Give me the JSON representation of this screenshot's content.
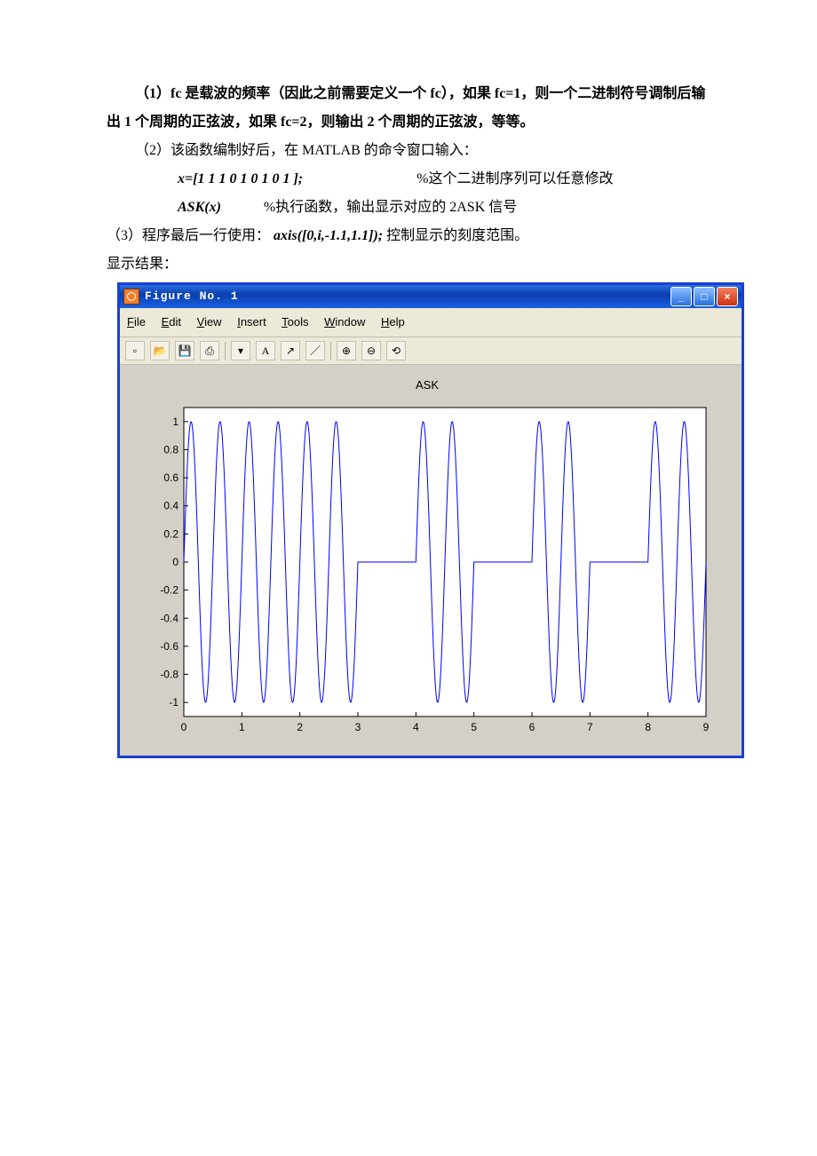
{
  "text": {
    "p1a": "（1）fc 是载波的频率（因此之前需要定义一个 fc），如果 fc=1，则一个二进制符号调制后输出 1 个周期的正弦波，如果 fc=2，则输出 2 个周期的正弦波，等等。",
    "p2": "（2）该函数编制好后，在 MATLAB 的命令窗口输入：",
    "code1": "x=[1 1 1 0 1 0 1 0 1 ];",
    "code1_comment": "%这个二进制序列可以任意修改",
    "code2": "ASK(x)",
    "code2_comment": "%执行函数，输出显示对应的 2ASK 信号",
    "p3a": "（3）程序最后一行使用：  ",
    "p3b": "axis([0,i,-1.1,1.1]);",
    "p3c": "   控制显示的刻度范围。",
    "p4": "显示结果："
  },
  "window": {
    "title": "Figure No. 1",
    "menu": {
      "file": "File",
      "edit": "Edit",
      "view": "View",
      "insert": "Insert",
      "tools": "Tools",
      "window": "Window",
      "help": "Help"
    }
  },
  "chart_data": {
    "type": "line",
    "title": "ASK",
    "xlabel": "",
    "ylabel": "",
    "xlim": [
      0,
      9
    ],
    "ylim": [
      -1.1,
      1.1
    ],
    "xticks": [
      0,
      1,
      2,
      3,
      4,
      5,
      6,
      7,
      8,
      9
    ],
    "yticks": [
      -1,
      -0.8,
      -0.6,
      -0.4,
      -0.2,
      0,
      0.2,
      0.4,
      0.6,
      0.8,
      1
    ],
    "bit_sequence": [
      1,
      1,
      1,
      0,
      1,
      0,
      1,
      0,
      1
    ],
    "fc": 2,
    "description": "2ASK signal: for each bit=1 emit fc sine periods of amplitude 1, for bit=0 emit zero line",
    "series": [
      {
        "name": "ASK",
        "color": "#0000ff",
        "segments": [
          {
            "x0": 0,
            "x1": 1,
            "type": "sine",
            "cycles": 2
          },
          {
            "x0": 1,
            "x1": 2,
            "type": "sine",
            "cycles": 2
          },
          {
            "x0": 2,
            "x1": 3,
            "type": "sine",
            "cycles": 2
          },
          {
            "x0": 3,
            "x1": 4,
            "type": "zero"
          },
          {
            "x0": 4,
            "x1": 5,
            "type": "sine",
            "cycles": 2
          },
          {
            "x0": 5,
            "x1": 6,
            "type": "zero"
          },
          {
            "x0": 6,
            "x1": 7,
            "type": "sine",
            "cycles": 2
          },
          {
            "x0": 7,
            "x1": 8,
            "type": "zero"
          },
          {
            "x0": 8,
            "x1": 9,
            "type": "sine",
            "cycles": 2
          }
        ]
      }
    ]
  }
}
